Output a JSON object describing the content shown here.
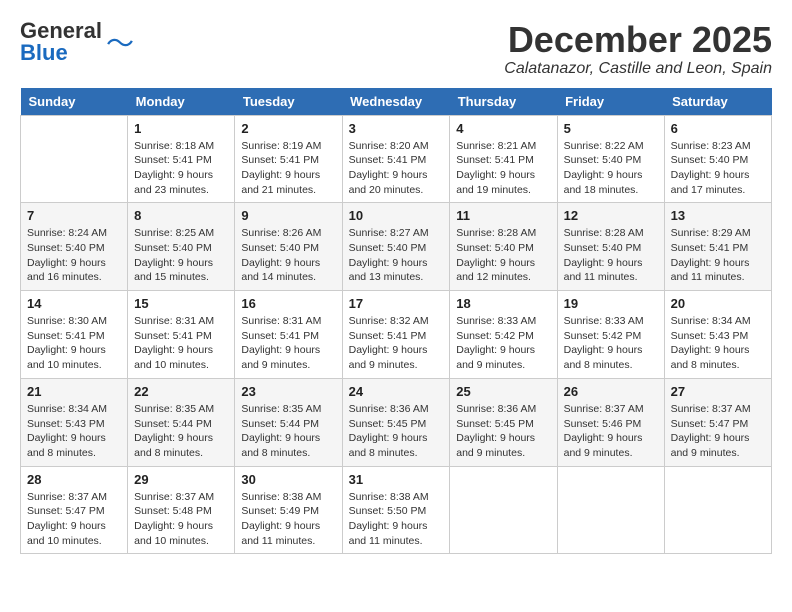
{
  "logo": {
    "general": "General",
    "blue": "Blue"
  },
  "title": {
    "month_year": "December 2025",
    "location": "Calatanazor, Castille and Leon, Spain"
  },
  "headers": [
    "Sunday",
    "Monday",
    "Tuesday",
    "Wednesday",
    "Thursday",
    "Friday",
    "Saturday"
  ],
  "weeks": [
    [
      {
        "day": "",
        "info": ""
      },
      {
        "day": "1",
        "info": "Sunrise: 8:18 AM\nSunset: 5:41 PM\nDaylight: 9 hours\nand 23 minutes."
      },
      {
        "day": "2",
        "info": "Sunrise: 8:19 AM\nSunset: 5:41 PM\nDaylight: 9 hours\nand 21 minutes."
      },
      {
        "day": "3",
        "info": "Sunrise: 8:20 AM\nSunset: 5:41 PM\nDaylight: 9 hours\nand 20 minutes."
      },
      {
        "day": "4",
        "info": "Sunrise: 8:21 AM\nSunset: 5:41 PM\nDaylight: 9 hours\nand 19 minutes."
      },
      {
        "day": "5",
        "info": "Sunrise: 8:22 AM\nSunset: 5:40 PM\nDaylight: 9 hours\nand 18 minutes."
      },
      {
        "day": "6",
        "info": "Sunrise: 8:23 AM\nSunset: 5:40 PM\nDaylight: 9 hours\nand 17 minutes."
      }
    ],
    [
      {
        "day": "7",
        "info": "Sunrise: 8:24 AM\nSunset: 5:40 PM\nDaylight: 9 hours\nand 16 minutes."
      },
      {
        "day": "8",
        "info": "Sunrise: 8:25 AM\nSunset: 5:40 PM\nDaylight: 9 hours\nand 15 minutes."
      },
      {
        "day": "9",
        "info": "Sunrise: 8:26 AM\nSunset: 5:40 PM\nDaylight: 9 hours\nand 14 minutes."
      },
      {
        "day": "10",
        "info": "Sunrise: 8:27 AM\nSunset: 5:40 PM\nDaylight: 9 hours\nand 13 minutes."
      },
      {
        "day": "11",
        "info": "Sunrise: 8:28 AM\nSunset: 5:40 PM\nDaylight: 9 hours\nand 12 minutes."
      },
      {
        "day": "12",
        "info": "Sunrise: 8:28 AM\nSunset: 5:40 PM\nDaylight: 9 hours\nand 11 minutes."
      },
      {
        "day": "13",
        "info": "Sunrise: 8:29 AM\nSunset: 5:41 PM\nDaylight: 9 hours\nand 11 minutes."
      }
    ],
    [
      {
        "day": "14",
        "info": "Sunrise: 8:30 AM\nSunset: 5:41 PM\nDaylight: 9 hours\nand 10 minutes."
      },
      {
        "day": "15",
        "info": "Sunrise: 8:31 AM\nSunset: 5:41 PM\nDaylight: 9 hours\nand 10 minutes."
      },
      {
        "day": "16",
        "info": "Sunrise: 8:31 AM\nSunset: 5:41 PM\nDaylight: 9 hours\nand 9 minutes."
      },
      {
        "day": "17",
        "info": "Sunrise: 8:32 AM\nSunset: 5:41 PM\nDaylight: 9 hours\nand 9 minutes."
      },
      {
        "day": "18",
        "info": "Sunrise: 8:33 AM\nSunset: 5:42 PM\nDaylight: 9 hours\nand 9 minutes."
      },
      {
        "day": "19",
        "info": "Sunrise: 8:33 AM\nSunset: 5:42 PM\nDaylight: 9 hours\nand 8 minutes."
      },
      {
        "day": "20",
        "info": "Sunrise: 8:34 AM\nSunset: 5:43 PM\nDaylight: 9 hours\nand 8 minutes."
      }
    ],
    [
      {
        "day": "21",
        "info": "Sunrise: 8:34 AM\nSunset: 5:43 PM\nDaylight: 9 hours\nand 8 minutes."
      },
      {
        "day": "22",
        "info": "Sunrise: 8:35 AM\nSunset: 5:44 PM\nDaylight: 9 hours\nand 8 minutes."
      },
      {
        "day": "23",
        "info": "Sunrise: 8:35 AM\nSunset: 5:44 PM\nDaylight: 9 hours\nand 8 minutes."
      },
      {
        "day": "24",
        "info": "Sunrise: 8:36 AM\nSunset: 5:45 PM\nDaylight: 9 hours\nand 8 minutes."
      },
      {
        "day": "25",
        "info": "Sunrise: 8:36 AM\nSunset: 5:45 PM\nDaylight: 9 hours\nand 9 minutes."
      },
      {
        "day": "26",
        "info": "Sunrise: 8:37 AM\nSunset: 5:46 PM\nDaylight: 9 hours\nand 9 minutes."
      },
      {
        "day": "27",
        "info": "Sunrise: 8:37 AM\nSunset: 5:47 PM\nDaylight: 9 hours\nand 9 minutes."
      }
    ],
    [
      {
        "day": "28",
        "info": "Sunrise: 8:37 AM\nSunset: 5:47 PM\nDaylight: 9 hours\nand 10 minutes."
      },
      {
        "day": "29",
        "info": "Sunrise: 8:37 AM\nSunset: 5:48 PM\nDaylight: 9 hours\nand 10 minutes."
      },
      {
        "day": "30",
        "info": "Sunrise: 8:38 AM\nSunset: 5:49 PM\nDaylight: 9 hours\nand 11 minutes."
      },
      {
        "day": "31",
        "info": "Sunrise: 8:38 AM\nSunset: 5:50 PM\nDaylight: 9 hours\nand 11 minutes."
      },
      {
        "day": "",
        "info": ""
      },
      {
        "day": "",
        "info": ""
      },
      {
        "day": "",
        "info": ""
      }
    ]
  ]
}
